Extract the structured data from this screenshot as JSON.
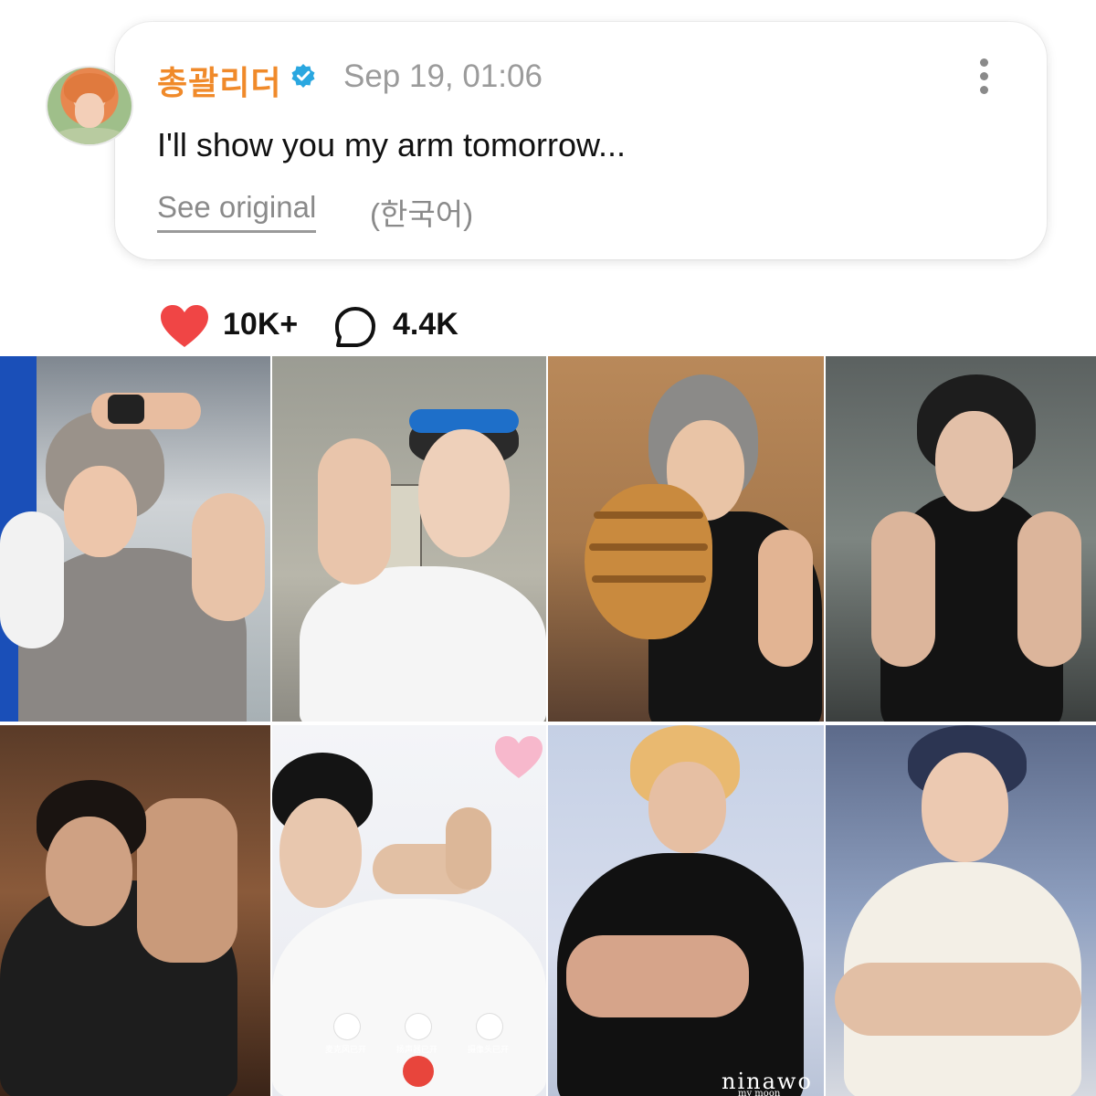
{
  "post": {
    "author": "총괄리더",
    "timestamp": "Sep 19, 01:06",
    "text": "I'll show you my arm tomorrow...",
    "see_original": "See original",
    "language": "(한국어)"
  },
  "stats": {
    "likes": "10K+",
    "comments": "4.4K"
  },
  "colors": {
    "author": "#f08a2a",
    "verified": "#2aa7e0",
    "heart": "#f04545"
  },
  "icons": {
    "verified": "verified-badge-icon",
    "more": "more-vertical-icon",
    "like": "heart-icon",
    "comment": "comment-bubble-icon"
  },
  "photo_overlays": {
    "call_labels": [
      "麦克风已开",
      "扬声器已开",
      "摄像头已开"
    ],
    "watermark": "ninawo",
    "watermark_sub": "my moon"
  }
}
